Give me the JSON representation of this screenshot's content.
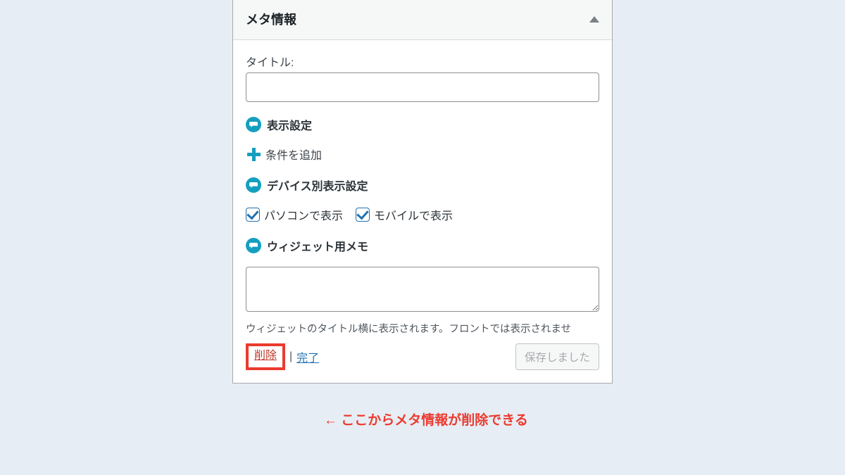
{
  "widget": {
    "header_title": "メタ情報",
    "title_label": "タイトル:",
    "title_value": "",
    "sections": {
      "display_settings": "表示設定",
      "add_condition": "条件を追加",
      "device_settings": "デバイス別表示設定",
      "widget_memo": "ウィジェット用メモ"
    },
    "checkboxes": {
      "pc": {
        "label": "パソコンで表示",
        "checked": true
      },
      "mobile": {
        "label": "モバイルで表示",
        "checked": true
      }
    },
    "memo_value": "",
    "helper_text": "ウィジェットのタイトル横に表示されます。フロントでは表示されませ",
    "footer": {
      "delete": "削除",
      "separator": "|",
      "done": "完了",
      "saved": "保存しました"
    }
  },
  "annotation": {
    "text": "← ここからメタ情報が削除できる"
  },
  "colors": {
    "accent": "#159fbf",
    "danger": "#eb3b2e",
    "link": "#2271b1"
  }
}
